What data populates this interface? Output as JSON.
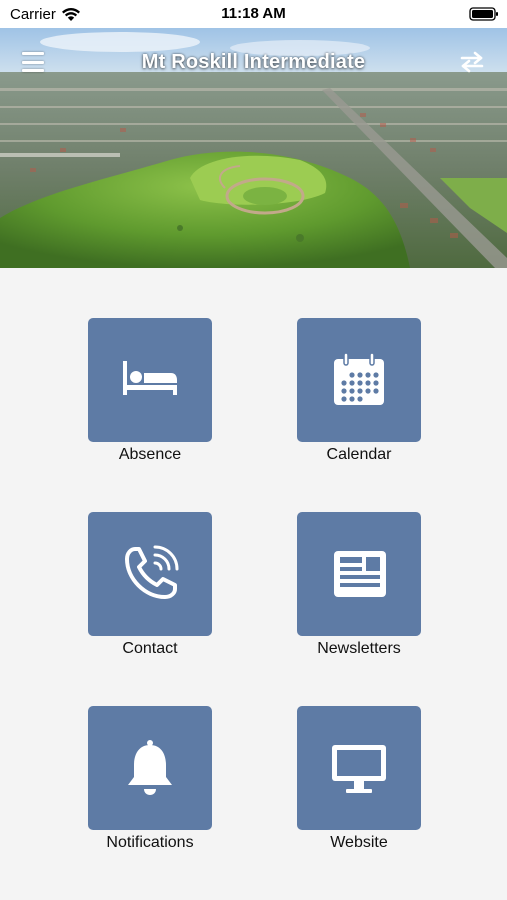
{
  "status_bar": {
    "carrier": "Carrier",
    "time": "11:18 AM"
  },
  "header": {
    "title": "Mt Roskill Intermediate"
  },
  "colors": {
    "tile": "#5e7ba5",
    "background": "#f4f4f4"
  },
  "tiles": [
    {
      "label": "Absence",
      "icon": "bed-icon"
    },
    {
      "label": "Calendar",
      "icon": "calendar-icon"
    },
    {
      "label": "Contact",
      "icon": "phone-icon"
    },
    {
      "label": "Newsletters",
      "icon": "newspaper-icon"
    },
    {
      "label": "Notifications",
      "icon": "bell-icon"
    },
    {
      "label": "Website",
      "icon": "monitor-icon"
    }
  ]
}
